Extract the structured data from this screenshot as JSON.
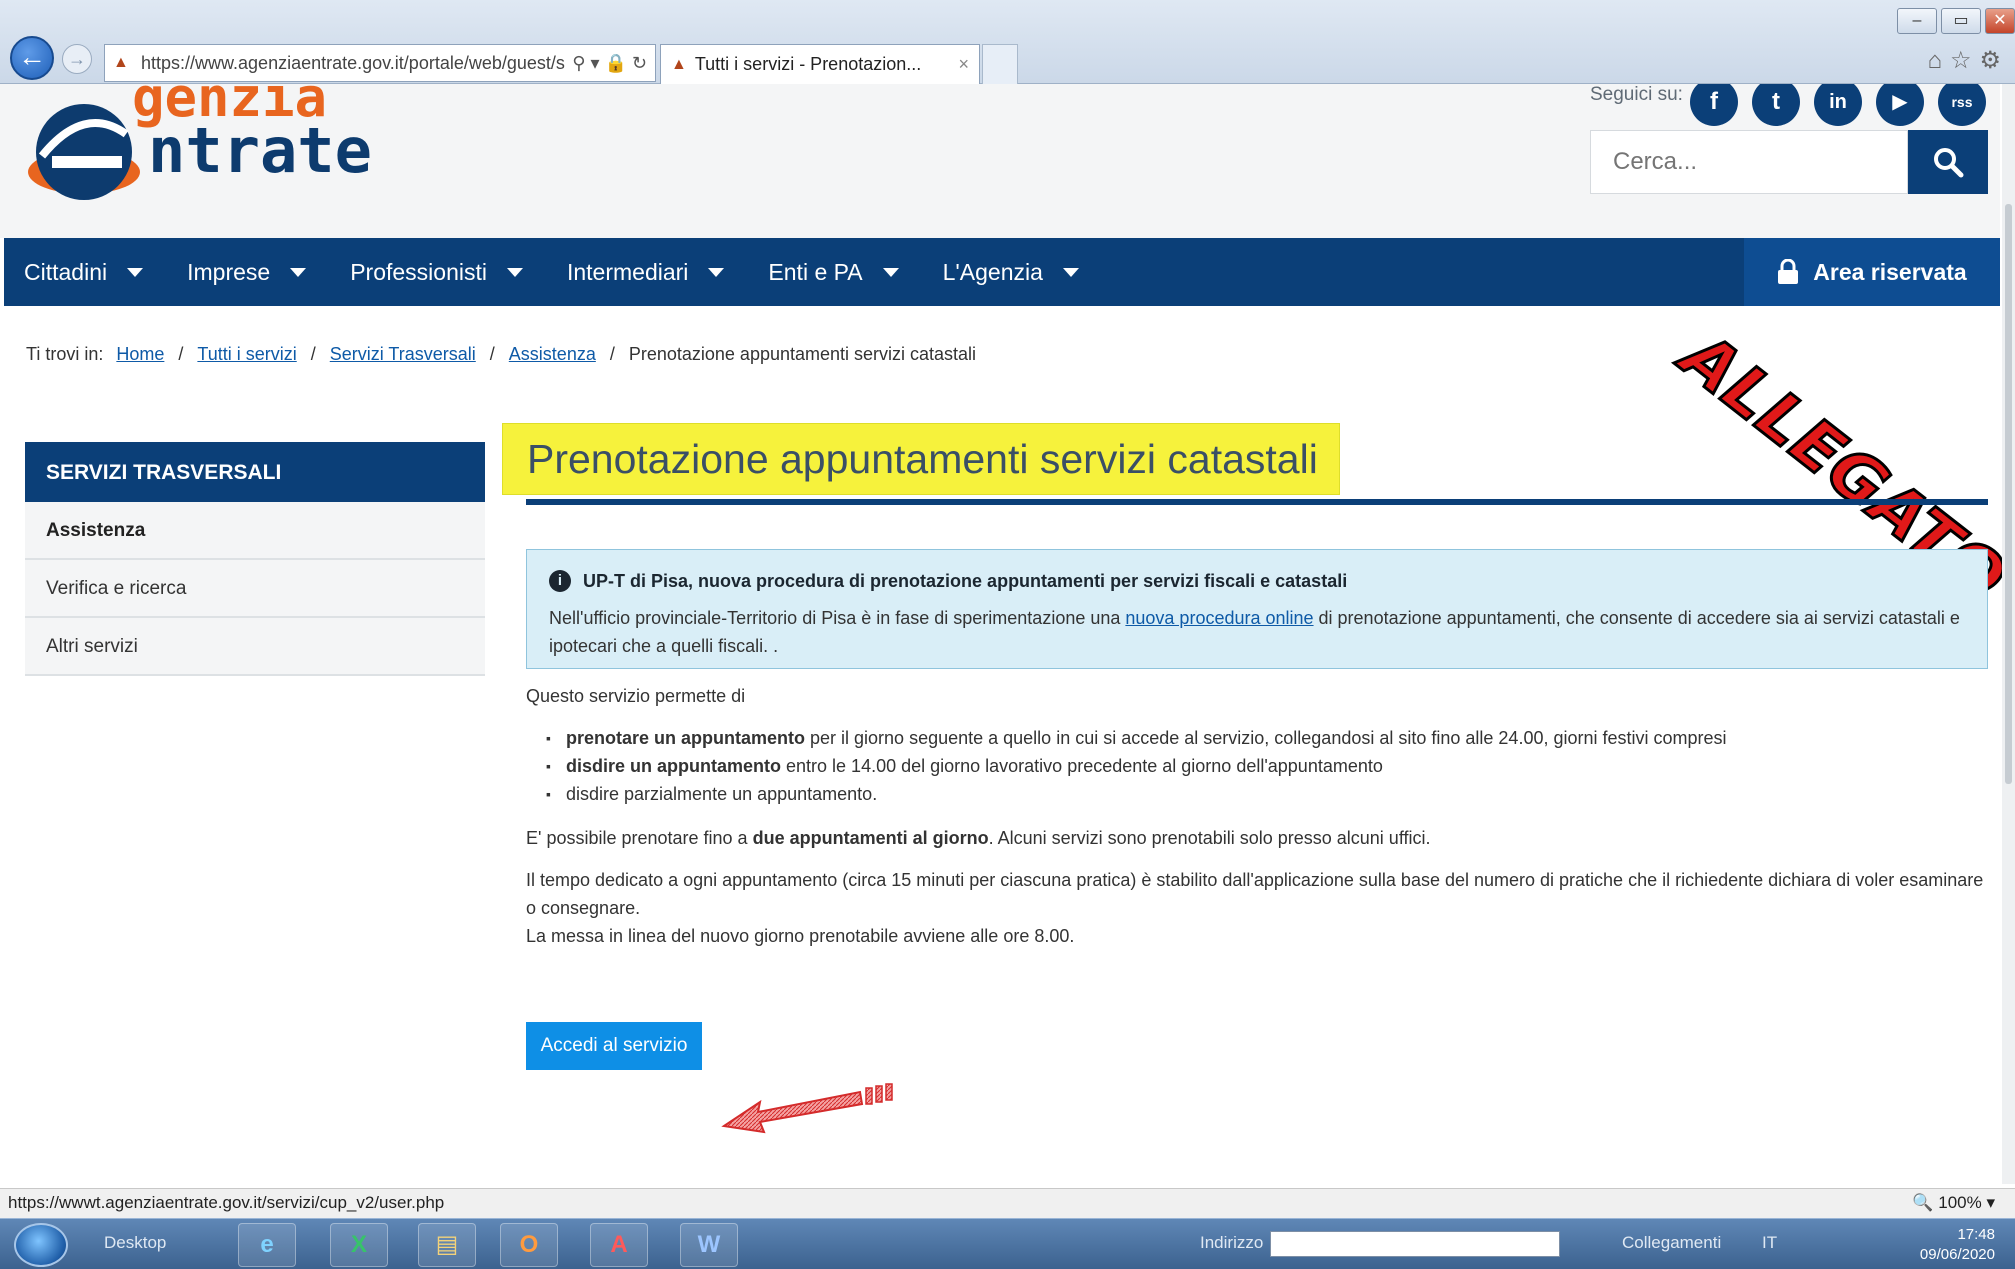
{
  "browser": {
    "url": "https://www.agenziaentrate.gov.it/portale/web/guest/s",
    "url_tools": "⚲ ▾ 🔒 ↻",
    "tab_title": "Tutti i servizi - Prenotazion...",
    "tab_close": "×"
  },
  "header": {
    "logo_top": "genzia",
    "logo_main": "ntrate",
    "social_label": "Seguici su:",
    "social": [
      "f",
      "t",
      "in",
      "▶",
      "rss"
    ],
    "search_placeholder": "Cerca..."
  },
  "nav": {
    "items": [
      "Cittadini",
      "Imprese",
      "Professionisti",
      "Intermediari",
      "Enti e PA",
      "L'Agenzia"
    ],
    "area_riservata": "Area riservata"
  },
  "breadcrumb": {
    "prefix": "Ti trovi in:",
    "links": [
      "Home",
      "Tutti i servizi",
      "Servizi Trasversali",
      "Assistenza"
    ],
    "current": "Prenotazione appuntamenti servizi catastali"
  },
  "stamp": "ALLEGATO",
  "sidebar": {
    "title": "SERVIZI TRASVERSALI",
    "items": [
      "Assistenza",
      "Verifica e ricerca",
      "Altri servizi"
    ]
  },
  "content": {
    "title": "Prenotazione appuntamenti servizi catastali",
    "notice_title": "UP-T di Pisa, nuova procedura di prenotazione appuntamenti per servizi fiscali e catastali",
    "notice_text_1": "Nell'ufficio provinciale-Territorio di Pisa è in fase di sperimentazione una ",
    "notice_link": "nuova procedura online",
    "notice_text_2": " di prenotazione appuntamenti, che consente di accedere sia ai servizi catastali e ipotecari che a quelli fiscali. .",
    "intro": "Questo servizio permette di",
    "bullet1_bold": "prenotare un appuntamento",
    "bullet1_rest": " per il giorno seguente a quello in cui si accede al servizio, collegandosi al sito fino alle 24.00, giorni festivi compresi",
    "bullet2_bold": "disdire un appuntamento",
    "bullet2_rest": " entro le 14.00 del giorno lavorativo precedente al giorno dell'appuntamento",
    "bullet3": "disdire parzialmente un appuntamento.",
    "para2_a": "E' possibile prenotare fino a ",
    "para2_bold": "due appuntamenti al giorno",
    "para2_b": ". Alcuni servizi sono prenotabili solo presso alcuni uffici.",
    "para3": "Il tempo dedicato a ogni appuntamento (circa 15 minuti per ciascuna pratica) è stabilito dall'applicazione sulla base del numero di pratiche che il richiedente dichiara di voler esaminare o consegnare.",
    "para4": "La messa in linea del nuovo giorno prenotabile avviene alle ore 8.00.",
    "button": "Accedi al servizio"
  },
  "status_bar": {
    "url": "https://wwwt.agenziaentrate.gov.it/servizi/cup_v2/user.php",
    "zoom": "🔍 100%  ▾"
  },
  "taskbar": {
    "desktop": "Desktop",
    "indirizzo": "Indirizzo",
    "collegamenti": "Collegamenti",
    "lang": "IT",
    "time": "17:48",
    "date": "09/06/2020",
    "apps": [
      "e",
      "X",
      "▤",
      "O",
      "A",
      "W"
    ]
  }
}
